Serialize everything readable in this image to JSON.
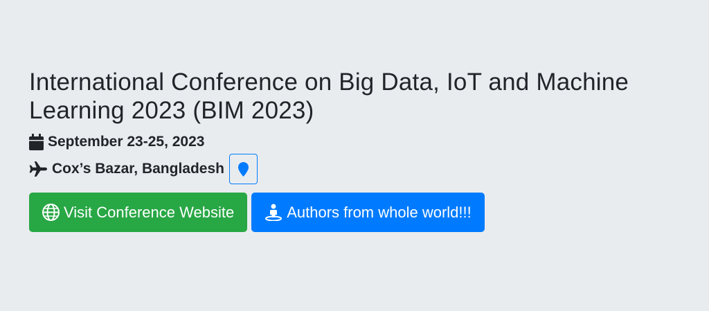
{
  "conference": {
    "title": "International Conference on Big Data, IoT and Machine Learning 2023 (BIM 2023)",
    "date": "September 23-25, 2023",
    "location": "Cox’s Bazar, Bangladesh"
  },
  "icons": {
    "date": "calendar-icon",
    "location": "plane-icon",
    "map": "map-marker-icon",
    "website": "globe-icon",
    "authors": "person-icon"
  },
  "buttons": {
    "website_label": "Visit Conference Website",
    "authors_label": "Authors from whole world!!!"
  },
  "colors": {
    "background": "#e9ecef",
    "text": "#212529",
    "success": "#28a745",
    "primary": "#007bff"
  }
}
